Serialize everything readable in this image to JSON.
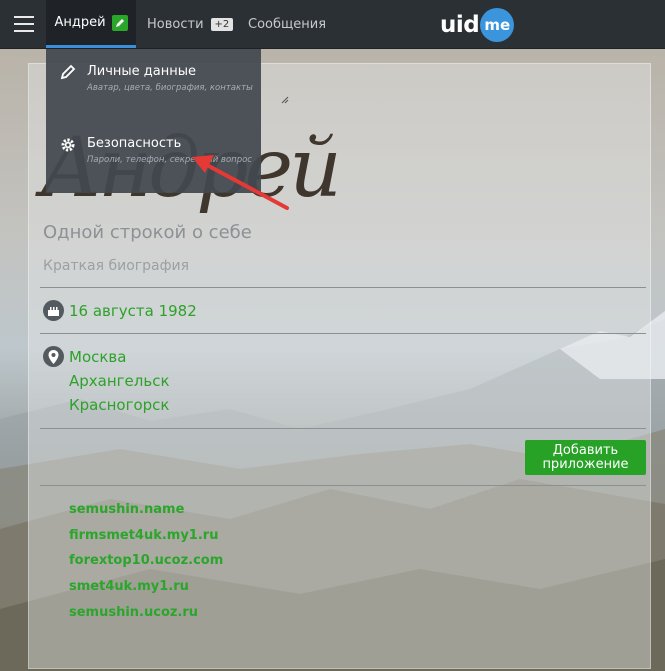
{
  "topbar": {
    "user_tab": "Андрей",
    "news_tab": "Новости",
    "news_count": "+2",
    "messages_tab": "Сообщения",
    "logo_uid": "uid",
    "logo_me": "me"
  },
  "profile": {
    "name_display": "Андрей",
    "one_line_placeholder": "Одной строкой о себе",
    "bio_placeholder": "Краткая биография",
    "birthday": "16 августа 1982",
    "cities": [
      "Москва",
      "Архангельск",
      "Красногорск"
    ],
    "add_app_button": "Добавить приложение",
    "links": [
      "semushin.name",
      "firmsmet4uk.my1.ru",
      "forextop10.ucoz.com",
      "smet4uk.my1.ru",
      "semushin.ucoz.ru"
    ]
  },
  "dropdown": {
    "items": [
      {
        "title": "Личные данные",
        "desc": "Аватар, цвета, биография, контакты",
        "icon": "pencil-icon"
      },
      {
        "title": "Безопасность",
        "desc": "Пароли, телефон, секретный вопрос",
        "icon": "gear-icon"
      }
    ]
  },
  "colors": {
    "accent_green": "#2aa62a",
    "accent_blue": "#3a95dc",
    "topbar": "#2b3035",
    "annotation_arrow": "#e53935"
  }
}
